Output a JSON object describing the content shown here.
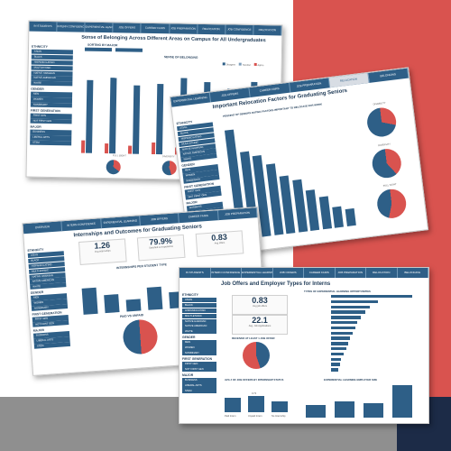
{
  "colors": {
    "accent": "#2e5f87",
    "red": "#d9534f",
    "navy": "#1c2b47",
    "grey": "#8f8f8f"
  },
  "panel1": {
    "tabs": [
      "IN STUDENTS",
      "INTERN CONFIDENCE",
      "EXPERIENTIAL LEARNING",
      "JOB OFFERS",
      "CAREER FAIRS",
      "JOB PREPARATION",
      "RELOCATION",
      "JOB CONFIDENCE",
      "RELOCATION"
    ],
    "title": "Sense of Belonging Across Different Areas on Campus for All Undergraduates",
    "sidebar": [
      {
        "group": "ETHNICITY",
        "items": [
          "ASIAN",
          "BLACK",
          "HISPANIC/LATINO",
          "MULTI-ETHNIC",
          "NATIVE HAWAIIAN",
          "NATIVE AMERICAN",
          "WHITE"
        ]
      },
      {
        "group": "GENDER",
        "items": [
          "MEN",
          "WOMEN",
          "NONBINARY"
        ]
      },
      {
        "group": "FIRST GENERATION",
        "items": [
          "FIRST GEN",
          "NOT FIRST GEN"
        ]
      },
      {
        "group": "MAJOR",
        "items": [
          "BUSINESS",
          "LIBERAL ARTS",
          "STEM"
        ]
      }
    ],
    "filter_label": "SORTING BY MAJOR",
    "chart_label": "SENSE OF BELONGING",
    "legend": [
      "Disagree",
      "Neutral",
      "Agree"
    ],
    "pie_labels": [
      "FULL SIGHT",
      "DIVERSITY"
    ]
  },
  "panel2": {
    "tabs": [
      "EXPERIENTIAL LEARNING",
      "JOB OFFERS",
      "CAREER FAIRS",
      "JOB PREPARATION",
      "RELOCATION",
      "BELONGING"
    ],
    "title": "Important Relocation Factors for Graduating Seniors",
    "chart_label": "PERCENT OF SENIORS RATING FACTORS IMPORTANT TO RELOCATE FOR WORK",
    "pie_labels": [
      "DISABILITY",
      "DIVERSITY",
      "FULL SIGHT"
    ]
  },
  "panel3": {
    "tabs": [
      "OVERVIEW",
      "INTERN CONFIDENCE",
      "EXPERIENTIAL LEARNING",
      "JOB OFFERS",
      "CAREER FAIRS",
      "JOB PREPARATION"
    ],
    "title": "Internships and Outcomes for Graduating Seniors",
    "kpis": [
      {
        "value": "1.26",
        "label": "Avg internships"
      },
      {
        "value": "79.9%",
        "label": "Satisfied w/ experience"
      },
      {
        "value": "0.83",
        "label": "Avg offers"
      }
    ],
    "chart_label": "INTERNSHIPS PER STUDENT TYPE",
    "pie_label": "PAID VS UNPAID"
  },
  "panel4": {
    "tabs": [
      "IN STUDENTS",
      "INTERN CONFIDENCE",
      "EXPERIENTIAL LEARNING",
      "JOB OFFERS",
      "CAREER FAIRS",
      "JOB PREPARATION",
      "RELOCATION",
      "BELONGING"
    ],
    "title": "Job Offers and Employer Types for Interns",
    "kpis": [
      {
        "value": "0.83",
        "label": "Avg job offers"
      },
      {
        "value": "22.1",
        "label": "Avg. Job Applications"
      }
    ],
    "pie_label": "RECEIVED AT LEAST 1 JOB OFFER",
    "hbar_label": "TYPES OF EXPERIENTIAL LEARNING OPPORTUNITIES",
    "bottom_left_label": "AVG # OF JOB OFFERS BY INTERNSHIP STATUS",
    "bottom_left_cats": [
      "Paid Intern",
      "Unpaid Intern",
      "No Internship"
    ],
    "bottom_left_values": [
      "",
      "0.73",
      ""
    ],
    "bottom_right_label": "EXPERIENTIAL LEARNING EMPLOYER SIZE"
  }
}
